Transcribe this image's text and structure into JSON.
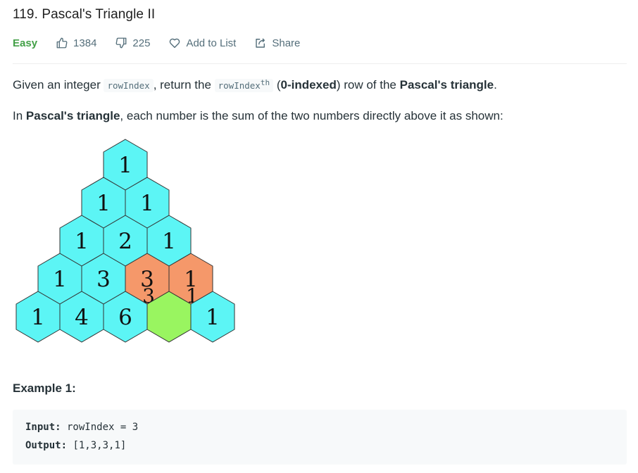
{
  "problem": {
    "title": "119. Pascal's Triangle II",
    "difficulty": "Easy",
    "likes": "1384",
    "dislikes": "225",
    "add_to_list": "Add to List",
    "share": "Share"
  },
  "description": {
    "p1": {
      "t1": "Given an integer ",
      "code1": "rowIndex",
      "t2": ", return the ",
      "code2": "rowIndex",
      "sup": "th",
      "t3": " (",
      "bold1": "0-indexed",
      "t4": ") row of the ",
      "bold2": "Pascal's triangle",
      "t5": "."
    },
    "p2": {
      "t1": "In ",
      "bold1": "Pascal's triangle",
      "t2": ", each number is the sum of the two numbers directly above it as shown:"
    }
  },
  "figure": {
    "rows": [
      [
        "1"
      ],
      [
        "1",
        "1"
      ],
      [
        "1",
        "2",
        "1"
      ],
      [
        "1",
        "3",
        "3",
        "1"
      ],
      [
        "1",
        "4",
        "6",
        "",
        "1"
      ]
    ],
    "highlighted_source": [
      [
        3,
        2
      ],
      [
        3,
        3
      ]
    ],
    "highlighted_target": [
      4,
      3
    ],
    "colors": {
      "cell": "#5cf5f5",
      "source": "#f5986a",
      "target": "#99f560",
      "stroke": "#333333"
    }
  },
  "example": {
    "title": "Example 1:",
    "input_label": "Input:",
    "input_value": " rowIndex = 3",
    "output_label": "Output:",
    "output_value": " [1,3,3,1]"
  }
}
